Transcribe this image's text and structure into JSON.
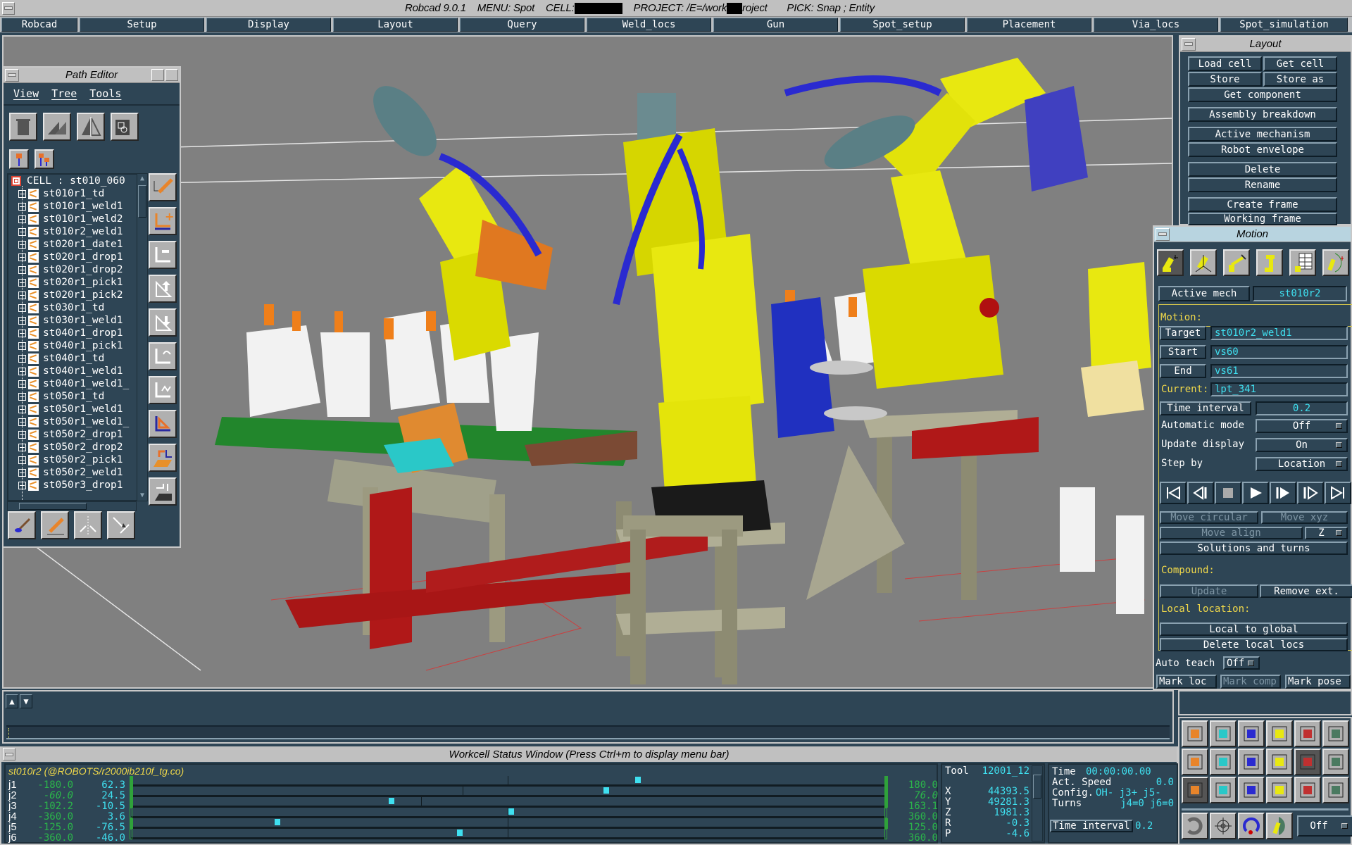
{
  "titlebar": {
    "app": "Robcad 9.0.1",
    "menu_prefix": "MENU: Spot",
    "cell_prefix": "CELL:",
    "project_prefix": "PROJECT: /E=/work",
    "project_suffix": "roject",
    "pick": "PICK: Snap ; Entity"
  },
  "main_menu": [
    "Robcad",
    "Setup",
    "Display",
    "Layout",
    "Query",
    "Weld_locs",
    "Gun",
    "Spot_setup",
    "Placement",
    "Via_locs",
    "Spot_simulation"
  ],
  "path_editor": {
    "title": "Path Editor",
    "menu": [
      "View",
      "Tree",
      "Tools"
    ],
    "toolbar_icons": [
      "trash-icon",
      "paths-icon",
      "mirror-path-icon",
      "component-attach-icon"
    ],
    "small_icons": [
      "single-location-icon",
      "multi-location-icon"
    ],
    "root": "CELL : st010_060",
    "operations": [
      "st010r1_td",
      "st010r1_weld1",
      "st010r1_weld2",
      "st010r2_weld1",
      "st020r1_date1",
      "st020r1_drop1",
      "st020r1_drop2",
      "st020r1_pick1",
      "st020r1_pick2",
      "st030r1_td",
      "st030r1_weld1",
      "st040r1_drop1",
      "st040r1_pick1",
      "st040r1_td",
      "st040r1_weld1",
      "st040r1_weld1_",
      "st050r1_td",
      "st050r1_weld1",
      "st050r1_weld1_",
      "st050r2_drop1",
      "st050r2_drop2",
      "st050r2_pick1",
      "st050r2_weld1",
      "st050r3_drop1"
    ],
    "side_tools": [
      "edit-location-icon",
      "add-location-icon",
      "delete-location-icon",
      "move-up-icon",
      "move-down-icon",
      "reverse-icon",
      "flip-icon",
      "swap-icon",
      "open-folder-icon",
      "paste-icon"
    ],
    "bottom_tools": [
      "paint-location-icon",
      "pencil-icon",
      "split-icon",
      "merge-icon"
    ]
  },
  "layout_window": {
    "title": "Layout",
    "buttons": [
      "Load cell",
      "Get cell",
      "Store",
      "Store as",
      "Get component",
      "Assembly breakdown",
      "Active mechanism",
      "Robot envelope",
      "Delete",
      "Rename",
      "Create frame",
      "Working frame"
    ]
  },
  "motion_window": {
    "title": "Motion",
    "mode_icons": [
      "joint-jog-icon",
      "cartesian-jog-icon",
      "tool-jog-icon",
      "robot-pose-icon",
      "robot-table-icon",
      "robot-envelope-icon"
    ],
    "active_mech_label": "Active mech",
    "active_mech": "st010r2",
    "motion_label": "Motion:",
    "target_label": "Target",
    "target": "st010r2_weld1",
    "start_label": "Start",
    "start": "vs60",
    "end_label": "End",
    "end": "vs61",
    "current_label": "Current:",
    "current": "lpt_341",
    "time_interval_label": "Time interval",
    "time_interval": "0.2",
    "automatic_mode_label": "Automatic mode",
    "automatic_mode": "Off",
    "update_display_label": "Update display",
    "update_display": "On",
    "step_by_label": "Step by",
    "step_by": "Location",
    "vcr": [
      "jump-to-start-icon",
      "step-back-icon",
      "stop-icon",
      "play-icon",
      "step-forward-icon",
      "step-forward-single-icon",
      "jump-to-end-icon"
    ],
    "move_circular": "Move circular",
    "move_xyz": "Move xyz",
    "move_align": "Move align",
    "align_axis": "Z",
    "solutions": "Solutions and turns",
    "compound_label": "Compound:",
    "update": "Update",
    "remove_ext": "Remove ext.",
    "local_label": "Local location:",
    "local_to_global": "Local to global",
    "delete_local": "Delete local locs",
    "auto_teach_label": "Auto teach",
    "auto_teach": "Off",
    "mark_loc": "Mark loc",
    "mark_comp": "Mark comp",
    "mark_pose": "Mark pose"
  },
  "palette": {
    "icons": [
      "spreadsheet-icon",
      "file-cabinet-icon",
      "table-zoom-icon",
      "search-path-icon",
      "toolbox-icon",
      "edit-frame-icon",
      "points-icon",
      "hierarchy-icon",
      "robot-gun-icon",
      "flag-icon",
      "robot-arm-icon",
      "axis-frame-icon",
      "path-icon",
      "layers-icon",
      "table-edit-icon",
      "book-edit-icon",
      "robot-table-icon",
      "chain-icon"
    ],
    "bottom_icons": [
      "refresh-icon",
      "target-icon",
      "redo-icon",
      "robot-reach-icon"
    ],
    "toggle": "Off"
  },
  "message_area": {
    "up": "▲",
    "down": "▼",
    "command": ""
  },
  "workcell_status": {
    "title": "Workcell Status Window  (Press Ctrl+m to display menu bar)",
    "robot": "st010r2 (@ROBOTS/r2000ib210f_tg.co)",
    "joints": [
      {
        "name": "j1",
        "min": "-180.0",
        "value": "62.3",
        "max": "180.0",
        "pos": 0.673,
        "italic": false,
        "hollow": false,
        "tick": 0.5
      },
      {
        "name": "j2",
        "min": "-60.0",
        "value": "24.5",
        "max": "76.0",
        "pos": 0.631,
        "italic": true,
        "hollow": false,
        "tick": 0.44
      },
      {
        "name": "j3",
        "min": "-102.2",
        "value": "-10.5",
        "max": "163.1",
        "pos": 0.346,
        "italic": false,
        "hollow": false,
        "tick": 0.385
      },
      {
        "name": "j4",
        "min": "-360.0",
        "value": "3.6",
        "max": "360.0",
        "pos": 0.505,
        "italic": false,
        "hollow": true,
        "tick": 0.5
      },
      {
        "name": "j5",
        "min": "-125.0",
        "value": "-76.5",
        "max": "125.0",
        "pos": 0.194,
        "italic": false,
        "hollow": false,
        "tick": 0.5
      },
      {
        "name": "j6",
        "min": "-360.0",
        "value": "-46.0",
        "max": "360.0",
        "pos": 0.436,
        "italic": false,
        "hollow": true,
        "tick": 0.5
      }
    ],
    "tool_label": "Tool",
    "tool": "12001_12",
    "coords": [
      {
        "axis": "X",
        "value": "44393.5"
      },
      {
        "axis": "Y",
        "value": "49281.3"
      },
      {
        "axis": "Z",
        "value": "1981.3"
      },
      {
        "axis": "R",
        "value": "-0.3"
      },
      {
        "axis": "P",
        "value": "-4.6"
      }
    ],
    "time_label": "Time",
    "time": "00:00:00.00",
    "speed_label": "Act. Speed",
    "speed": "0.0",
    "config_label": "Config.",
    "config": "OH- j3+ j5-",
    "turns_label": "Turns",
    "turns": "j4=0 j6=0",
    "time_interval_label": "Time interval",
    "time_interval": "0.2"
  }
}
